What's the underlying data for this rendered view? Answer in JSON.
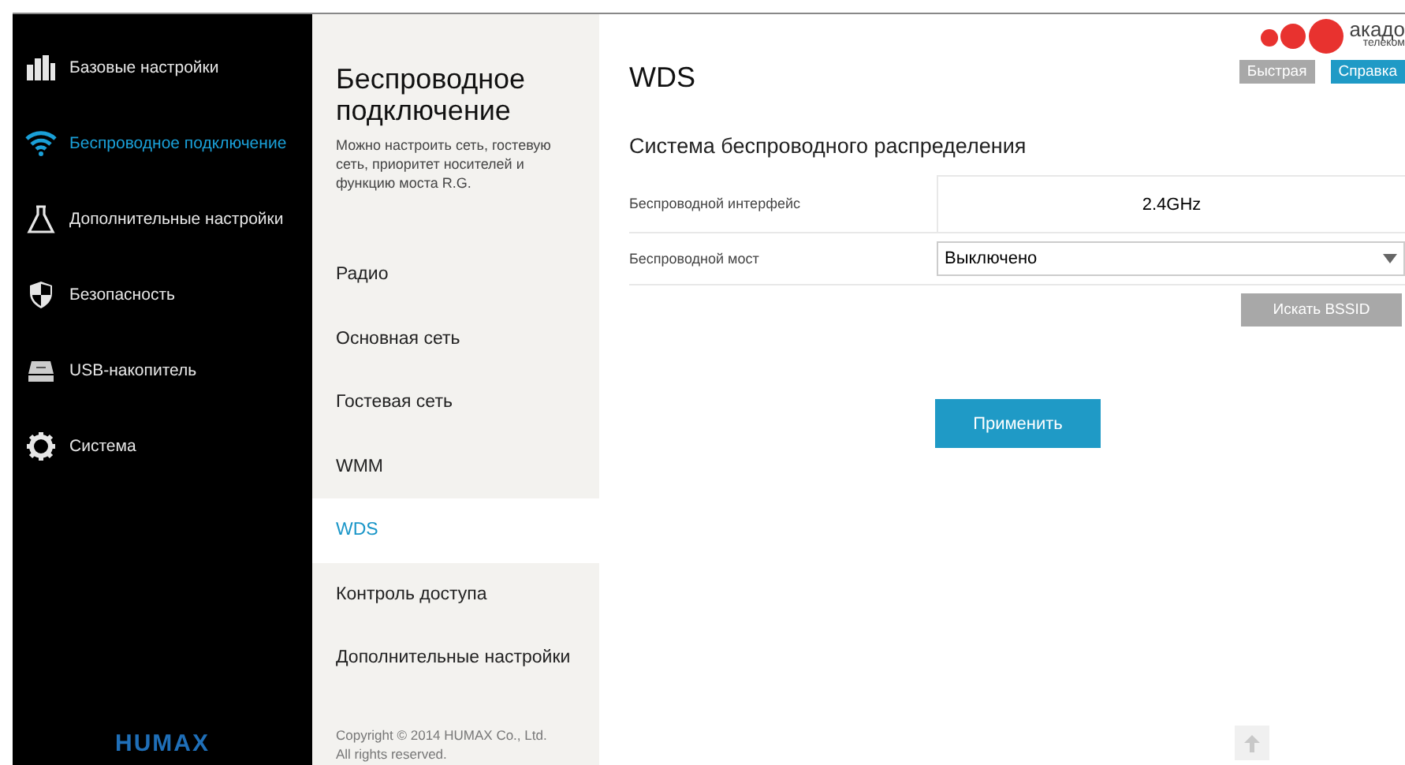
{
  "sidebar": {
    "items": [
      {
        "kind": "chart",
        "label": "Базовые настройки",
        "selected": false
      },
      {
        "kind": "wifi",
        "label": "Беспроводное подключение",
        "selected": true
      },
      {
        "kind": "flask",
        "label": "Дополнительные настройки",
        "selected": false
      },
      {
        "kind": "shield",
        "label": "Безопасность",
        "selected": false
      },
      {
        "kind": "drive",
        "label": "USB-накопитель",
        "selected": false
      },
      {
        "kind": "gear",
        "label": "Система",
        "selected": false
      }
    ],
    "brand": "HUMAX"
  },
  "section": {
    "title": "Беспроводное подключение",
    "description": "Можно настроить сеть, гостевую сеть, приоритет носителей и функцию моста R.G.",
    "items": [
      {
        "label": "Радио",
        "selected": false
      },
      {
        "label": "Основная сеть",
        "selected": false
      },
      {
        "label": "Гостевая сеть",
        "selected": false
      },
      {
        "label": "WMM",
        "selected": false
      },
      {
        "label": "WDS",
        "selected": true
      },
      {
        "label": "Контроль доступа",
        "selected": false
      },
      {
        "label": "Дополнительные настройки",
        "selected": false
      }
    ],
    "copyright": "Copyright © 2014 HUMAX Co., Ltd.",
    "rights": "All rights reserved."
  },
  "header": {
    "logo_name": "акадо",
    "logo_sub": "телеком",
    "buttons": [
      {
        "label": "Быстрая",
        "kind": "gray"
      },
      {
        "label": "Справка",
        "kind": "blue"
      }
    ]
  },
  "page": {
    "title": "WDS",
    "heading": "Система беспроводного распределения",
    "fields": [
      {
        "kind": "static",
        "label": "Беспроводной интерфейс",
        "value": "2.4GHz"
      },
      {
        "kind": "select",
        "label": "Беспроводной мост",
        "value": "Выключено"
      }
    ],
    "search_button": {
      "label": "Искать BSSID",
      "disabled": true
    },
    "apply_button": {
      "label": "Применить"
    }
  }
}
